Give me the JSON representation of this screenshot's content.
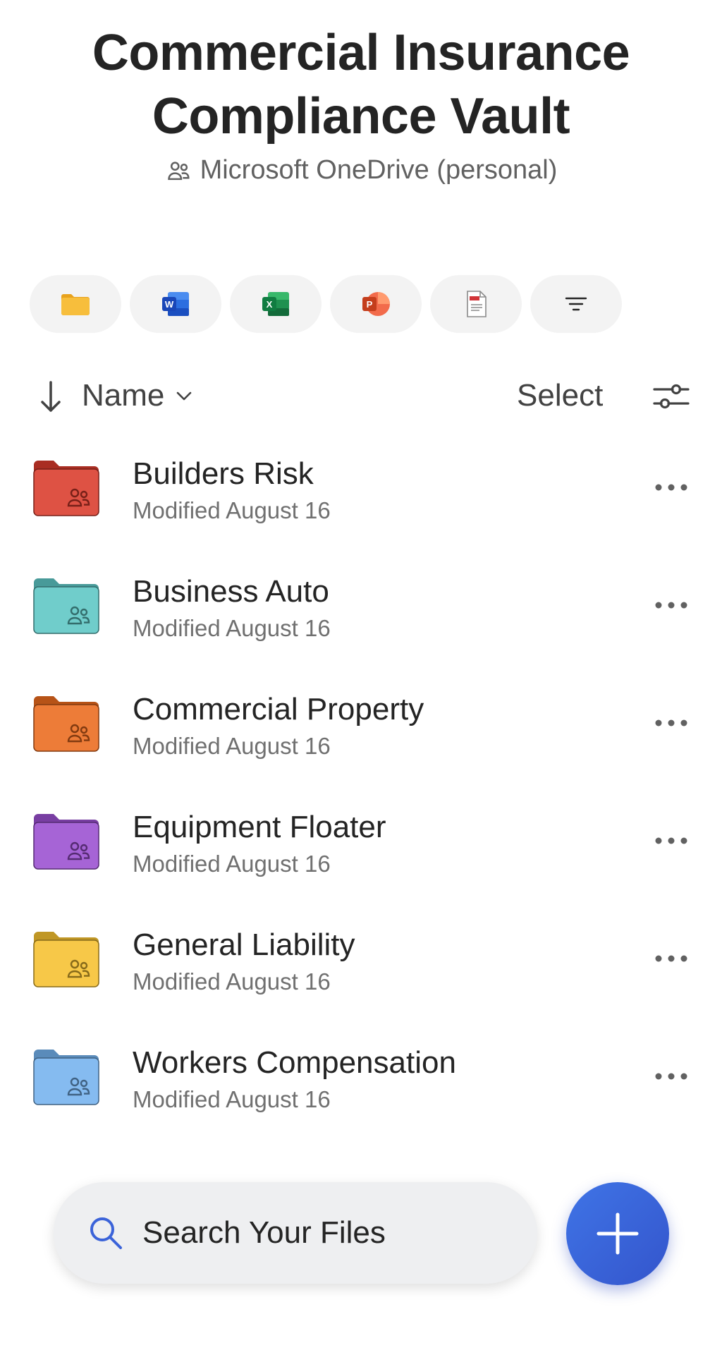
{
  "header": {
    "title_line1": "Commercial Insurance",
    "title_line2": "Compliance Vault",
    "location": "Microsoft OneDrive (personal)"
  },
  "filters": [
    {
      "icon": "folder-icon"
    },
    {
      "icon": "word-icon"
    },
    {
      "icon": "excel-icon"
    },
    {
      "icon": "powerpoint-icon"
    },
    {
      "icon": "pdf-icon"
    },
    {
      "icon": "filter-icon"
    }
  ],
  "sort": {
    "label": "Name",
    "select_label": "Select"
  },
  "folders": [
    {
      "name": "Builders Risk",
      "modified": "Modified August 16",
      "color": "#d93a2b"
    },
    {
      "name": "Business Auto",
      "modified": "Modified August 16",
      "color": "#5cc6c4"
    },
    {
      "name": "Commercial Property",
      "modified": "Modified August 16",
      "color": "#ea6a1d"
    },
    {
      "name": "Equipment Floater",
      "modified": "Modified August 16",
      "color": "#9a4fd0"
    },
    {
      "name": "General Liability",
      "modified": "Modified August 16",
      "color": "#f6c12f"
    },
    {
      "name": "Workers Compensation",
      "modified": "Modified August 16",
      "color": "#74b2ee"
    }
  ],
  "search": {
    "placeholder": "Search Your Files"
  },
  "colors": {
    "accent": "#3b63d9"
  }
}
